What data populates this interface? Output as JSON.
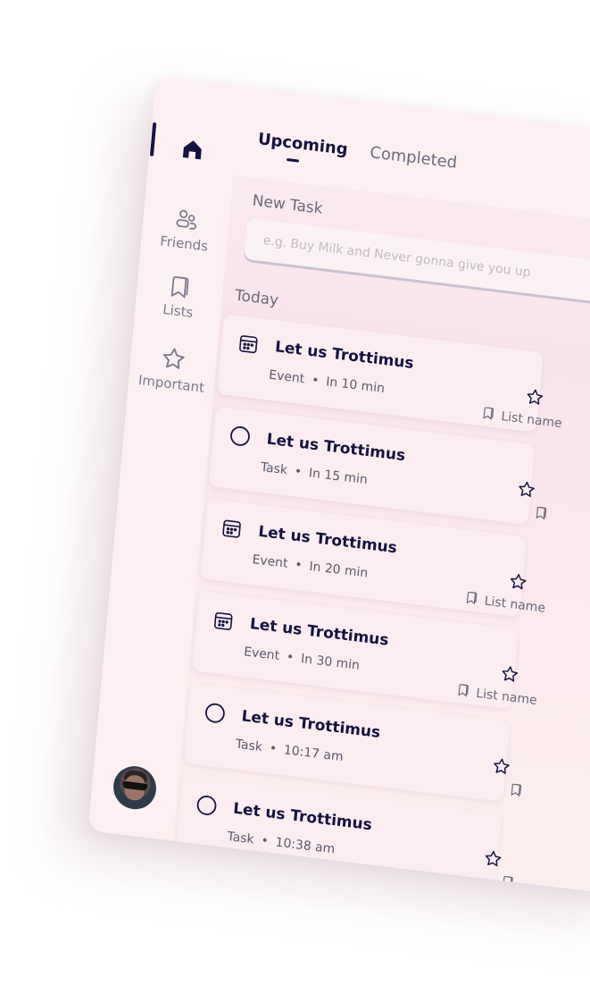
{
  "sidebar": {
    "items": [
      {
        "label": "",
        "icon": "home-icon"
      },
      {
        "label": "Friends",
        "icon": "friends-icon"
      },
      {
        "label": "Lists",
        "icon": "bookmark-icon"
      },
      {
        "label": "Important",
        "icon": "star-icon"
      }
    ],
    "active_index": 0
  },
  "tabs": [
    {
      "label": "Upcoming",
      "active": true
    },
    {
      "label": "Completed",
      "active": false
    }
  ],
  "new_task": {
    "label": "New Task",
    "placeholder": "e.g. Buy Milk and Never gonna give you up"
  },
  "section_label": "Today",
  "tasks": [
    {
      "icon": "calendar-icon",
      "title": "Let us Trottimus",
      "type": "Event",
      "time": "In 10 min",
      "starred": false,
      "list_name": "List name"
    },
    {
      "icon": "circle-icon",
      "title": "Let us Trottimus",
      "type": "Task",
      "time": "In 15 min",
      "starred": false,
      "list_name": ""
    },
    {
      "icon": "calendar-icon",
      "title": "Let us Trottimus",
      "type": "Event",
      "time": "In 20 min",
      "starred": false,
      "list_name": "List name"
    },
    {
      "icon": "calendar-icon",
      "title": "Let us Trottimus",
      "type": "Event",
      "time": "In 30 min",
      "starred": false,
      "list_name": "List name"
    },
    {
      "icon": "circle-icon",
      "title": "Let us Trottimus",
      "type": "Task",
      "time": "10:17 am",
      "starred": false,
      "list_name": ""
    },
    {
      "icon": "circle-icon",
      "title": "Let us Trottimus",
      "type": "Task",
      "time": "10:38 am",
      "starred": false,
      "list_name": ""
    }
  ],
  "meta_separator": "•",
  "colors": {
    "text_primary": "#14123f",
    "text_secondary": "#6a6879",
    "card_bg": "#fcedf1",
    "app_bg": "#fdf1f3"
  }
}
